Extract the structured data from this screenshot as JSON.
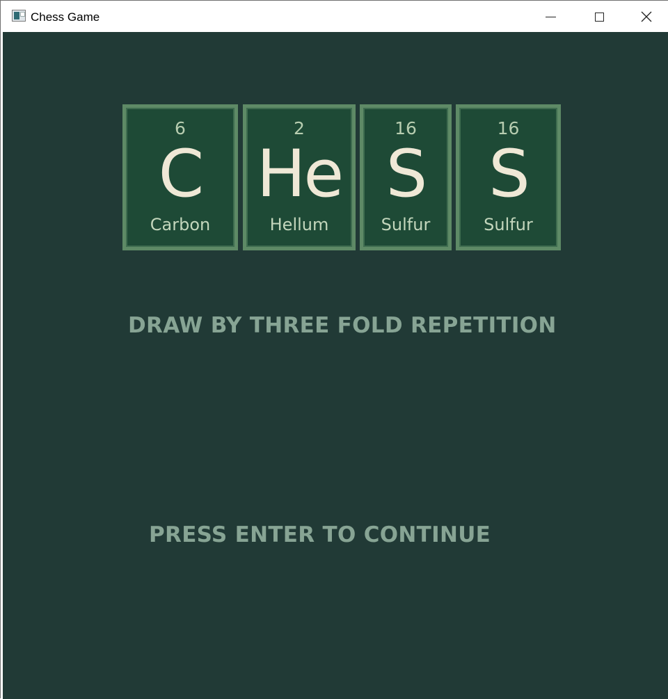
{
  "window": {
    "title": "Chess Game",
    "title_icon": "app-window-icon",
    "minimize_icon": "minimize-icon",
    "maximize_icon": "maximize-icon",
    "close_icon": "close-icon",
    "close_glyph": "✕"
  },
  "logo": {
    "tiles": [
      {
        "number": "6",
        "symbol": "C",
        "name": "Carbon"
      },
      {
        "number": "2",
        "symbol": "He",
        "name": "Hellum"
      },
      {
        "number": "16",
        "symbol": "S",
        "name": "Sulfur"
      },
      {
        "number": "16",
        "symbol": "S",
        "name": "Sulfur"
      }
    ]
  },
  "game": {
    "result_message": "DRAW BY THREE FOLD REPETITION",
    "continue_prompt": "PRESS ENTER TO CONTINUE"
  },
  "colors": {
    "background": "#213a36",
    "tile_border": "#5e8a66",
    "tile_fill": "#1e4a36",
    "symbol": "#efe8d6",
    "text": "#87a494"
  }
}
